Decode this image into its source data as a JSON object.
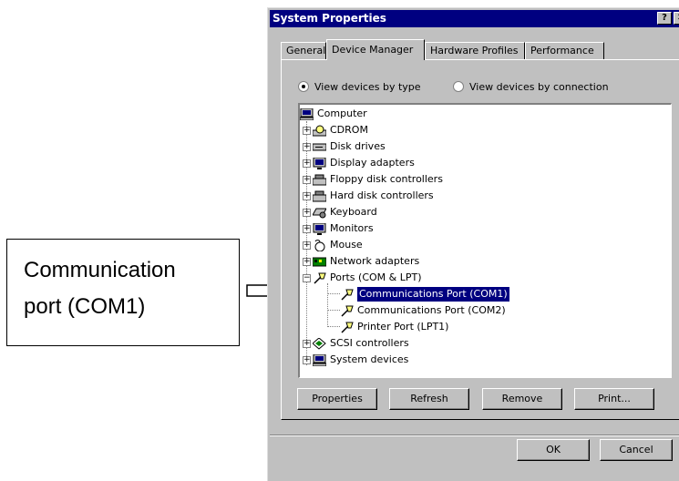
{
  "callout": {
    "line1": "Communication",
    "line2": "port (COM1)"
  },
  "window": {
    "title": "System Properties",
    "help_btn": "?",
    "close_btn": "✕"
  },
  "tabs": [
    "General",
    "Device Manager",
    "Hardware Profiles",
    "Performance"
  ],
  "view": {
    "by_type": "View devices by type",
    "by_connection": "View devices by connection"
  },
  "tree": {
    "root": "Computer",
    "items": [
      "CDROM",
      "Disk drives",
      "Display adapters",
      "Floppy disk controllers",
      "Hard disk controllers",
      "Keyboard",
      "Monitors",
      "Mouse",
      "Network adapters",
      "Ports (COM & LPT)"
    ],
    "ports": [
      "Communications Port (COM1)",
      "Communications Port (COM2)",
      "Printer Port (LPT1)"
    ],
    "tail": [
      "SCSI controllers",
      "System devices"
    ]
  },
  "buttons": {
    "properties": "Properties",
    "refresh": "Refresh",
    "remove": "Remove",
    "print": "Print...",
    "ok": "OK",
    "cancel": "Cancel"
  },
  "colors": {
    "titlebar": "#000080",
    "face": "#c0c0c0",
    "selection": "#000080"
  }
}
